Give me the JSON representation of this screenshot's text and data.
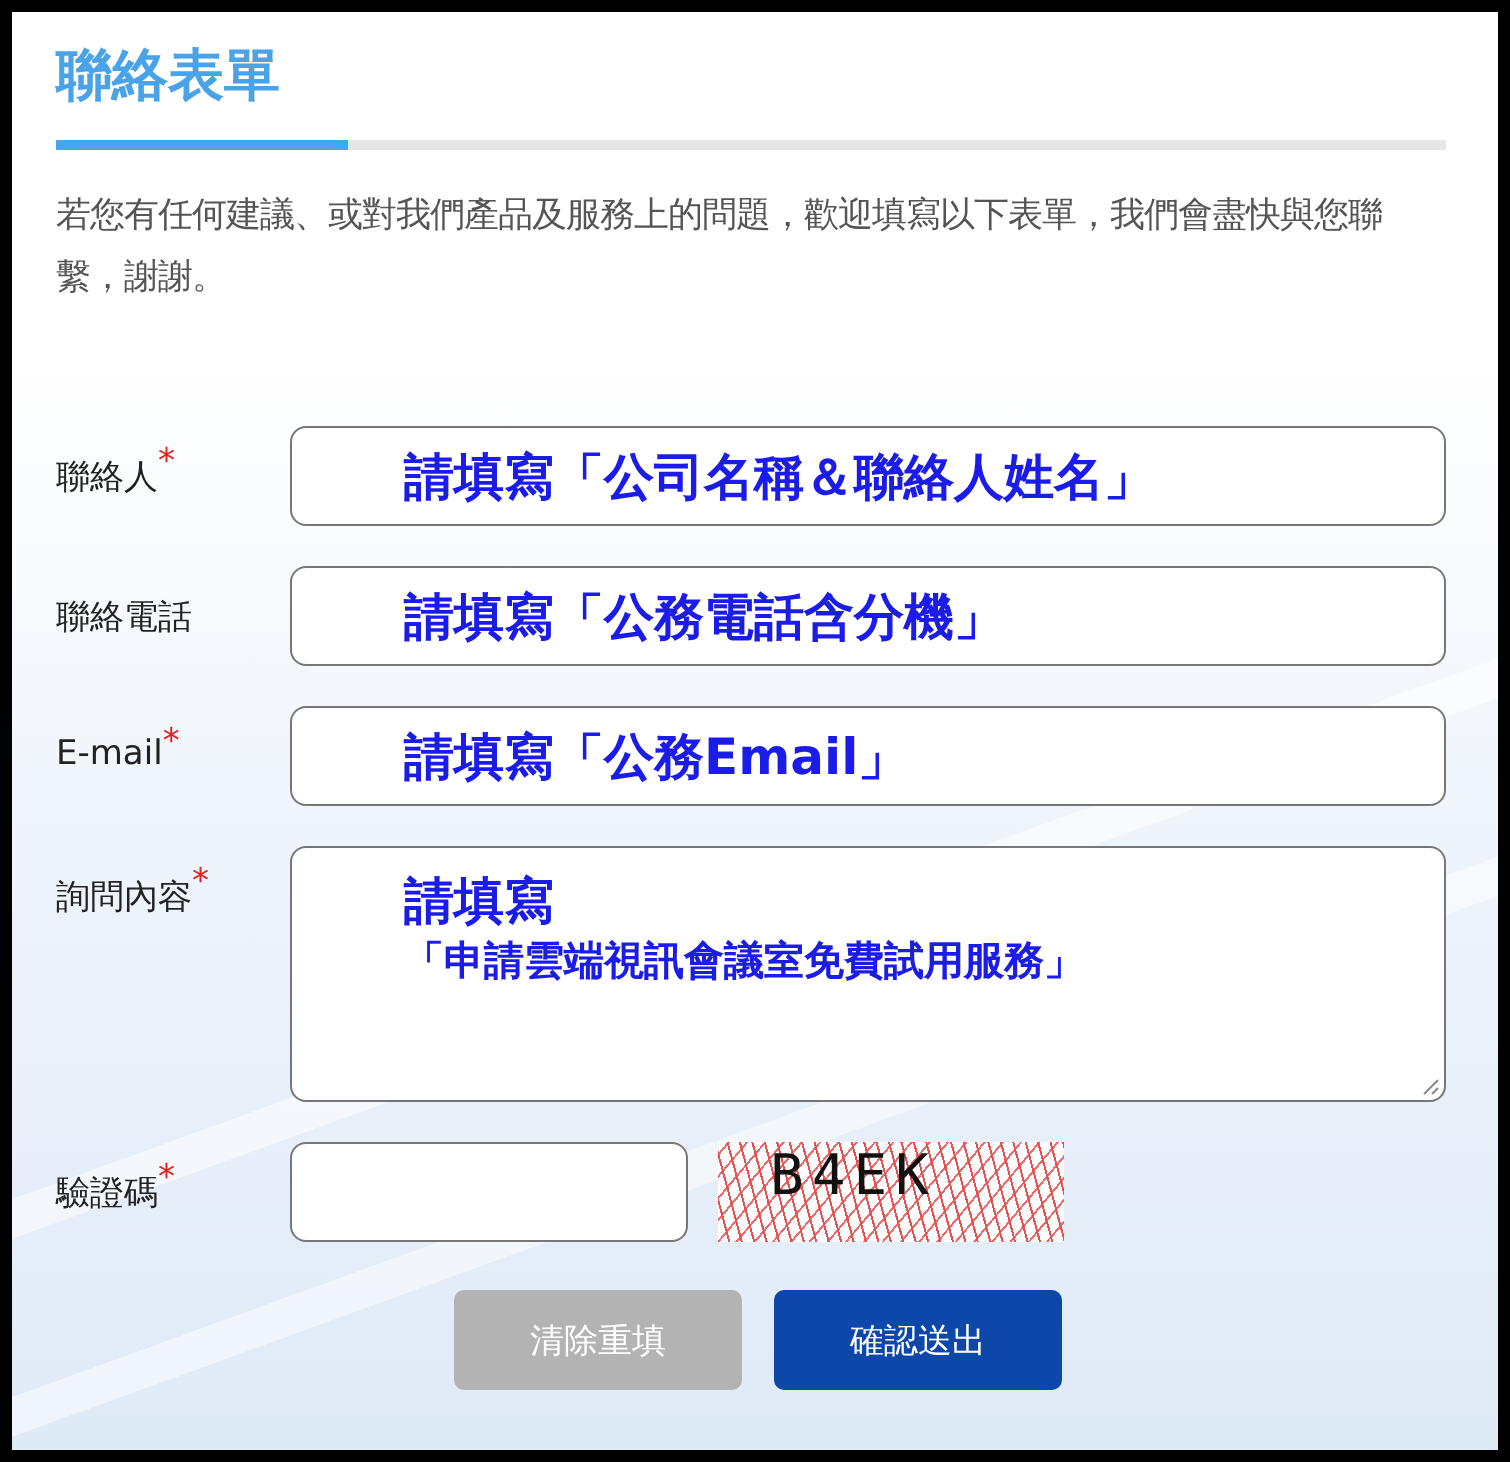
{
  "title": "聯絡表單",
  "progress": {
    "level": 0.21
  },
  "intro": "若您有任何建議、或對我們產品及服務上的問題，歡迎填寫以下表單，我們會盡快與您聯繫，謝謝。",
  "fields": [
    {
      "kind": "input",
      "label": "聯絡人",
      "required_mark": "*",
      "lines": [
        "請填寫「公司名稱＆聯絡人姓名」"
      ]
    },
    {
      "kind": "input",
      "label": "聯絡電話",
      "lines": [
        "請填寫「公務電話含分機」"
      ]
    },
    {
      "kind": "input",
      "label": "E-mail",
      "required_mark": "*",
      "lines": [
        "請填寫「公務Email」"
      ]
    },
    {
      "kind": "textarea",
      "label": "詢問內容",
      "required_mark": "*",
      "lines": [
        "請填寫",
        "「申請雲端視訊會議室免費試用服務」"
      ]
    },
    {
      "kind": "captcha",
      "label": "驗證碼",
      "required_mark": "*",
      "captcha": "B4EK"
    }
  ],
  "buttons": [
    {
      "label": "清除重填",
      "kind": "reset"
    },
    {
      "label": "確認送出",
      "kind": "submit"
    }
  ]
}
